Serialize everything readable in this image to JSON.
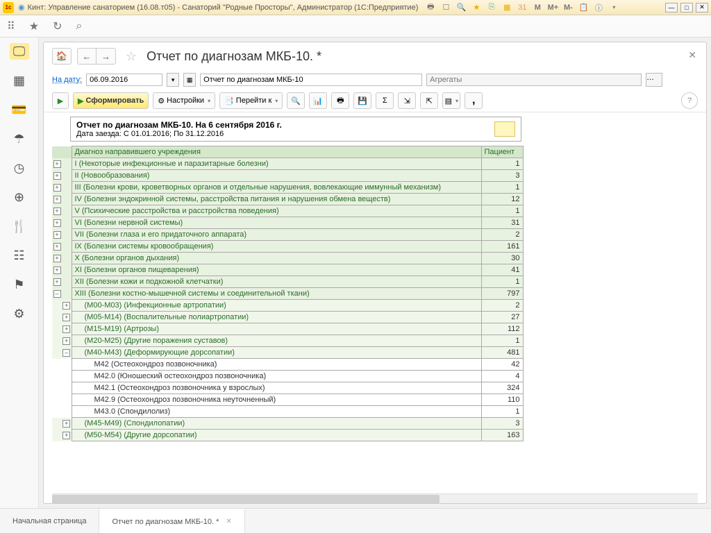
{
  "titlebar": {
    "title": "Кинт: Управление санаторием (16.08.т05) - Санаторий \"Родные Просторы\", Администратор  (1С:Предприятие)",
    "m1": "M",
    "m2": "M+",
    "m3": "M-"
  },
  "doc": {
    "title": "Отчет по диагнозам МКБ-10. *"
  },
  "params": {
    "date_label": "На дату:",
    "date_value": "06.09.2016",
    "desc_value": "Отчет по диагнозам МКБ-10",
    "agg_placeholder": "Агрегаты"
  },
  "toolbar": {
    "run": "Сформировать",
    "settings": "Настройки",
    "goto": "Перейти к"
  },
  "report_header": {
    "title": "Отчет по диагнозам МКБ-10. На 6 сентября 2016 г.",
    "sub": "Дата заезда: С 01.01.2016; По 31.12.2016"
  },
  "columns": {
    "diag": "Диагноз направившего учреждения",
    "pat": "Пациент"
  },
  "rows": [
    {
      "exp": "+",
      "lvl": 0,
      "diag": "I (Некоторые инфекционные и паразитарные болезни)",
      "pat": "1"
    },
    {
      "exp": "+",
      "lvl": 0,
      "diag": "II (Новообразования)",
      "pat": "3"
    },
    {
      "exp": "+",
      "lvl": 0,
      "diag": "III (Болезни крови, кроветворных органов и отдельные нарушения, вовлекающие иммунный механизм)",
      "pat": "1"
    },
    {
      "exp": "+",
      "lvl": 0,
      "diag": "IV (Болезни эндокринной системы, расстройства питания и нарушения обмена веществ)",
      "pat": "12"
    },
    {
      "exp": "+",
      "lvl": 0,
      "diag": "V (Психические расстройства и расстройства поведения)",
      "pat": "1"
    },
    {
      "exp": "+",
      "lvl": 0,
      "diag": "VI (Болезни нервной системы)",
      "pat": "31"
    },
    {
      "exp": "+",
      "lvl": 0,
      "diag": "VII (Болезни глаза и его придаточного аппарата)",
      "pat": "2"
    },
    {
      "exp": "+",
      "lvl": 0,
      "diag": "IX (Болезни системы кровообращения)",
      "pat": "161"
    },
    {
      "exp": "+",
      "lvl": 0,
      "diag": "X (Болезни органов дыхания)",
      "pat": "30"
    },
    {
      "exp": "+",
      "lvl": 0,
      "diag": "XI (Болезни органов пищеварения)",
      "pat": "41"
    },
    {
      "exp": "+",
      "lvl": 0,
      "diag": "XII (Болезни кожи и подкожной клетчатки)",
      "pat": "1"
    },
    {
      "exp": "–",
      "lvl": 0,
      "diag": "XIII (Болезни костно-мышечной системы и соединительной ткани)",
      "pat": "797"
    },
    {
      "exp": "+",
      "lvl": 1,
      "diag": "(M00-M03) (Инфекционные артропатии)",
      "pat": "2"
    },
    {
      "exp": "+",
      "lvl": 1,
      "diag": "(M05-M14) (Воспалительные полиартропатии)",
      "pat": "27"
    },
    {
      "exp": "+",
      "lvl": 1,
      "diag": "(M15-M19) (Артрозы)",
      "pat": "112"
    },
    {
      "exp": "+",
      "lvl": 1,
      "diag": "(M20-M25) (Другие поражения суставов)",
      "pat": "1"
    },
    {
      "exp": "–",
      "lvl": 1,
      "diag": "(M40-M43) (Деформирующие дорсопатии)",
      "pat": "481"
    },
    {
      "exp": "",
      "lvl": 2,
      "diag": "M42 (Остеохондроз позвоночника)",
      "pat": "42"
    },
    {
      "exp": "",
      "lvl": 2,
      "diag": "M42.0 (Юношеский остеохондроз позвоночника)",
      "pat": "4"
    },
    {
      "exp": "",
      "lvl": 2,
      "diag": "M42.1 (Остеохондроз позвоночника у взрослых)",
      "pat": "324"
    },
    {
      "exp": "",
      "lvl": 2,
      "diag": "M42.9 (Остеохондроз позвоночника неуточненный)",
      "pat": "110"
    },
    {
      "exp": "",
      "lvl": 2,
      "diag": "M43.0 (Спондилолиз)",
      "pat": "1"
    },
    {
      "exp": "+",
      "lvl": 1,
      "diag": "(M45-M49) (Спондилопатии)",
      "pat": "3"
    },
    {
      "exp": "+",
      "lvl": 1,
      "diag": "(M50-M54) (Другие дорсопатии)",
      "pat": "163"
    }
  ],
  "tabs": {
    "start": "Начальная страница",
    "doc": "Отчет по диагнозам МКБ-10. *"
  }
}
